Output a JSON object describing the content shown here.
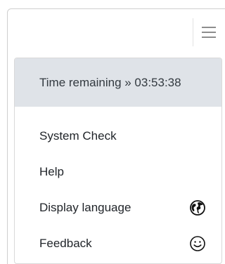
{
  "menu": {
    "time_remaining": "Time remaining » 03:53:38",
    "items": [
      {
        "label": "System Check",
        "icon": ""
      },
      {
        "label": "Help",
        "icon": ""
      },
      {
        "label": "Display language",
        "icon": "globe-icon"
      },
      {
        "label": "Feedback",
        "icon": "smiley-icon"
      }
    ]
  },
  "header": {
    "menu_icon": "hamburger-menu-icon"
  },
  "colors": {
    "banner_bg": "#dfe3e8",
    "text": "#1f2328",
    "hamburger": "#8d8d8d"
  }
}
